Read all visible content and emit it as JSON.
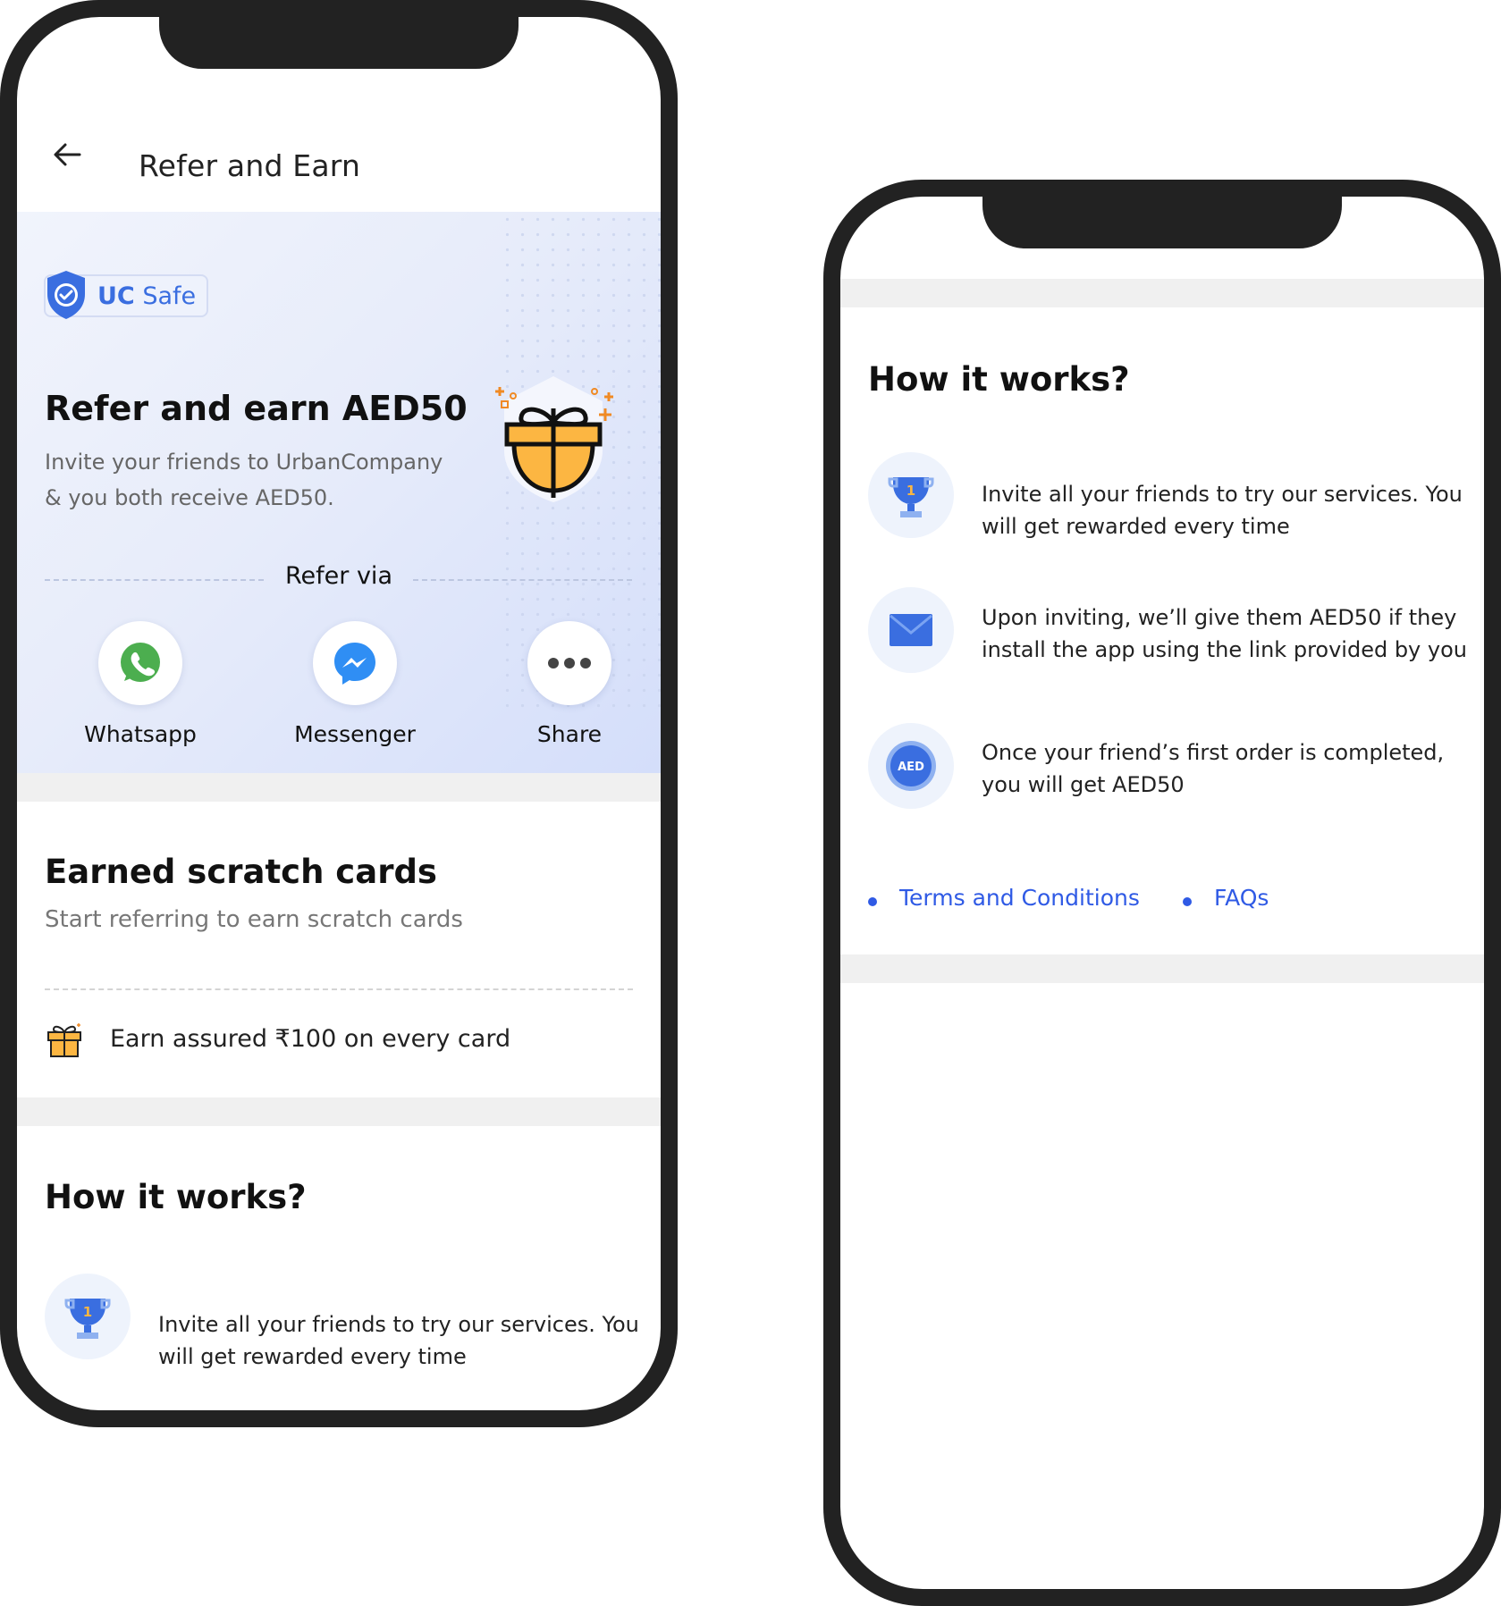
{
  "left_phone": {
    "header": {
      "title": "Refer and Earn"
    },
    "hero": {
      "badge_bold": "UC",
      "badge_text": "Safe",
      "title": "Refer and earn AED50",
      "subtitle_line1": "Invite your friends to UrbanCompany",
      "subtitle_line2": "& you both receive AED50.",
      "refer_via": "Refer via",
      "share_options": [
        {
          "label": "Whatsapp",
          "icon": "whatsapp-icon"
        },
        {
          "label": "Messenger",
          "icon": "messenger-icon"
        },
        {
          "label": "Share",
          "icon": "more-dots-icon"
        }
      ]
    },
    "scratch": {
      "title": "Earned scratch cards",
      "subtitle": "Start referring to earn scratch cards",
      "earn_text": "Earn assured ₹100 on every card"
    },
    "how": {
      "title": "How it works?",
      "steps": [
        {
          "line1": "Invite all your friends to try our services. You",
          "line2": "will get rewarded every time",
          "icon": "trophy-icon"
        }
      ]
    }
  },
  "right_phone": {
    "how": {
      "title": "How it works?",
      "steps": [
        {
          "line1": "Invite all your friends to try our services. You",
          "line2": "will get rewarded every time",
          "icon": "trophy-icon"
        },
        {
          "line1": "Upon inviting, we’ll give them AED50 if they",
          "line2": "install the app using the link provided by you",
          "icon": "mail-icon"
        },
        {
          "line1": "Once your friend’s first order is completed,",
          "line2": "you will get AED50",
          "icon": "aed-coin-icon",
          "icon_text": "AED"
        }
      ],
      "links": [
        "Terms and Conditions",
        "FAQs"
      ]
    }
  },
  "colors": {
    "accent": "#2f5ae5",
    "phone_frame": "#222222",
    "band": "#f0f0f0",
    "gift": "#fcb642"
  }
}
